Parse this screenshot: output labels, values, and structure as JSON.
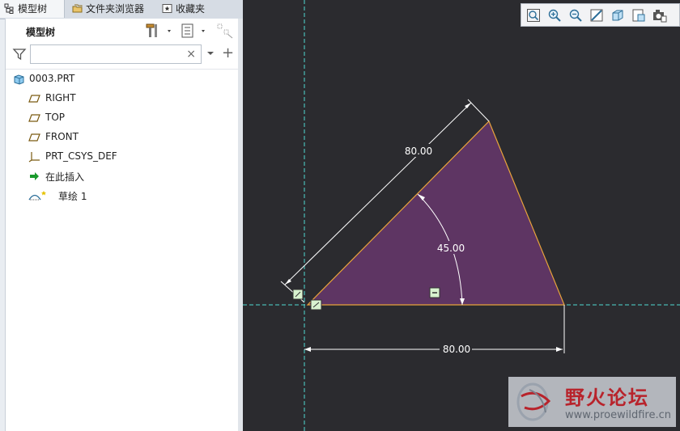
{
  "tabs": [
    {
      "label": "模型树",
      "icon": "model-tree-icon",
      "active": true
    },
    {
      "label": "文件夹浏览器",
      "icon": "folder-browser-icon",
      "active": false
    },
    {
      "label": "收藏夹",
      "icon": "favorites-icon",
      "active": false
    }
  ],
  "model_tree": {
    "title": "模型树",
    "filter_value": "",
    "clear_symbol": "×",
    "add_symbol": "+",
    "items": [
      {
        "label": "0003.PRT",
        "icon": "part-icon"
      },
      {
        "label": "RIGHT",
        "icon": "datum-plane-icon"
      },
      {
        "label": "TOP",
        "icon": "datum-plane-icon"
      },
      {
        "label": "FRONT",
        "icon": "datum-plane-icon"
      },
      {
        "label": "PRT_CSYS_DEF",
        "icon": "coordinate-system-icon"
      },
      {
        "label": "在此插入",
        "icon": "insert-here-arrow-icon"
      },
      {
        "label": "草绘 1",
        "icon": "sketch-icon"
      }
    ]
  },
  "sketch": {
    "dim_hyp": "80.00",
    "dim_angle": "45.00",
    "dim_base": "80.00",
    "fill_color": "#5e3563",
    "edge_color": "#e8a33b",
    "centerline_color": "#4fd8d0",
    "dimension_color": "#ffffff"
  },
  "watermark": {
    "title": "野火论坛",
    "url": "www.proewildfire.cn"
  },
  "colors": {
    "canvas_bg": "#2b2b2f",
    "panel_bg": "#e9edf2",
    "accent_red": "#b8232b"
  }
}
